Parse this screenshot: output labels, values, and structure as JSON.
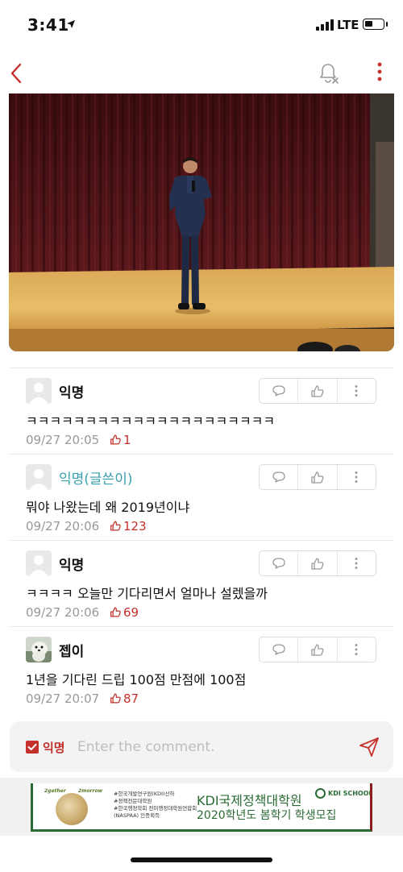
{
  "status_bar": {
    "time": "3:41",
    "network": "LTE",
    "battery_level": 0.45
  },
  "nav": {
    "back_icon": "chevron-left-icon",
    "notification_icon": "bell-off-icon",
    "more_icon": "vertical-ellipsis-icon",
    "accent_color": "#c4302b"
  },
  "comments": [
    {
      "author": "익명",
      "is_op": false,
      "avatar": "default-avatar",
      "text": "ㅋㅋㅋㅋㅋㅋㅋㅋㅋㅋㅋㅋㅋㅋㅋㅋㅋㅋㅋㅋㅋ",
      "time": "09/27 20:05",
      "likes": "1"
    },
    {
      "author": "익명(글쓴이)",
      "is_op": true,
      "avatar": "default-avatar",
      "text": "뭐야 나왔는데 왜 2019년이냐",
      "time": "09/27 20:06",
      "likes": "123"
    },
    {
      "author": "익명",
      "is_op": false,
      "avatar": "default-avatar",
      "text": "ㅋㅋㅋㅋ 오늘만 기다리면서 얼마나 설렜을까",
      "time": "09/27 20:06",
      "likes": "69"
    },
    {
      "author": "젭이",
      "is_op": false,
      "avatar": "photo-avatar",
      "text": "1년을 기다린 드립 100점 만점에 100점",
      "time": "09/27 20:07",
      "likes": "87"
    }
  ],
  "composer": {
    "anonymous_label": "익명",
    "anonymous_checked": true,
    "placeholder": "Enter the comment.",
    "send_icon": "send-icon"
  },
  "ad": {
    "brand_left": "2gether",
    "brand_right": "2morrow",
    "bullets": [
      "#한국개발연구원(KDI)산하",
      "#정책전문대학원",
      "#한국행정학회 전미행정대학원연합회",
      "(NASPAA) 인증획득"
    ],
    "title": "KDI국제정책대학원",
    "subtitle": "2020학년도 봄학기 학생모집",
    "logo_text": "KDI SCHOOL"
  }
}
